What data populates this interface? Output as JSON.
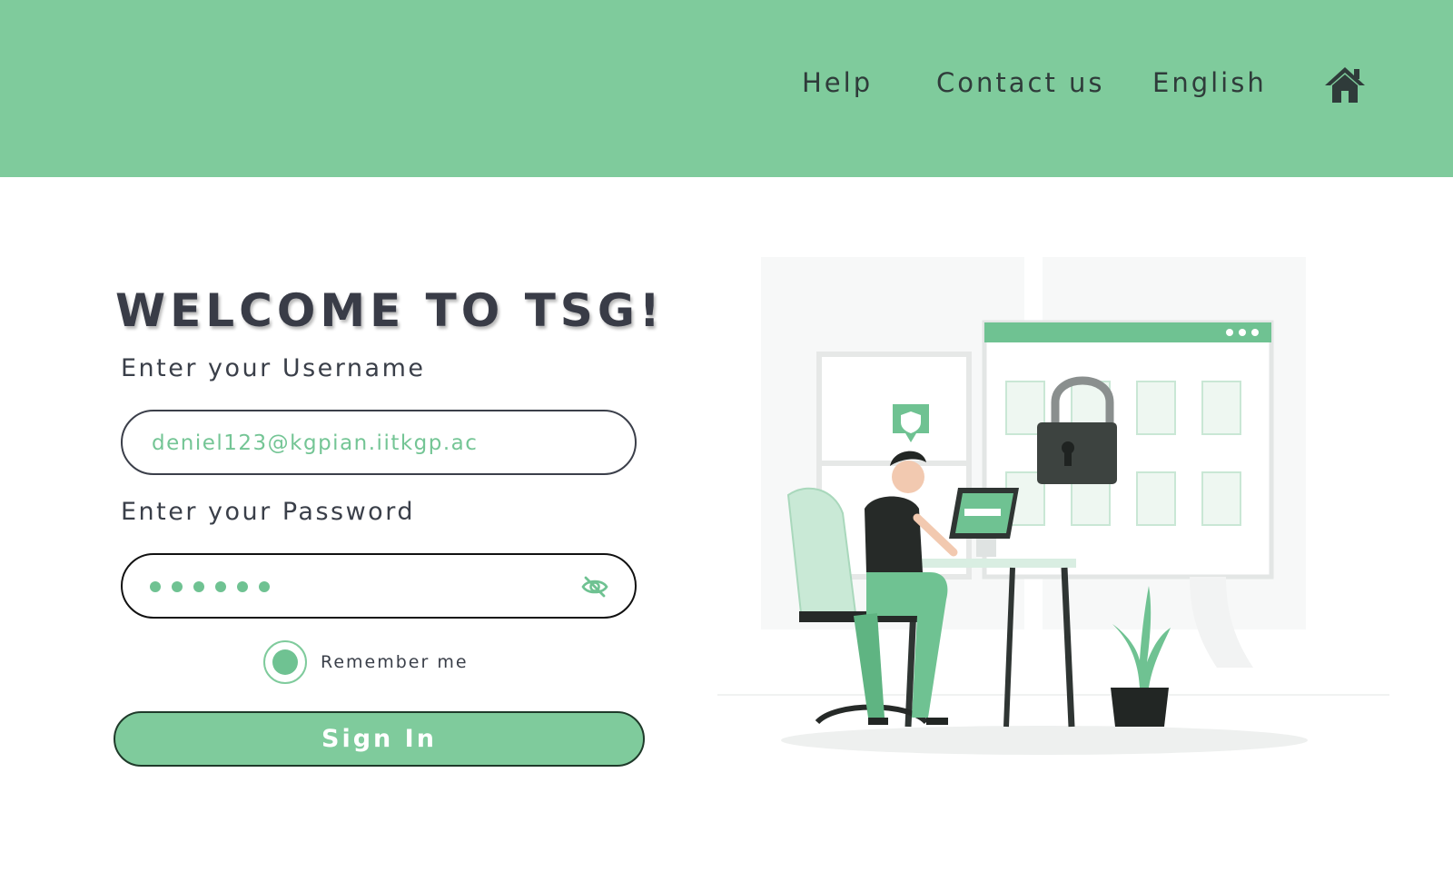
{
  "header": {
    "nav": {
      "help_label": "Help",
      "contact_label": "Contact us",
      "language_label": "English"
    },
    "home_icon": "home-icon"
  },
  "login": {
    "title": "WELCOME TO TSG!",
    "username": {
      "label": "Enter your Username",
      "value": "deniel123@kgpian.iitkgp.ac"
    },
    "password": {
      "label": "Enter your Password",
      "masked_length": 6,
      "toggle_icon": "eye-slash-icon"
    },
    "remember": {
      "label": "Remember me",
      "checked": true
    },
    "submit_label": "Sign In"
  },
  "illustration": {
    "subject": "person-at-desk-security-illustration"
  },
  "colors": {
    "accent": "#7fcb9c",
    "accent_dark": "#6fc292",
    "text_dark": "#393c47",
    "white": "#ffffff"
  }
}
